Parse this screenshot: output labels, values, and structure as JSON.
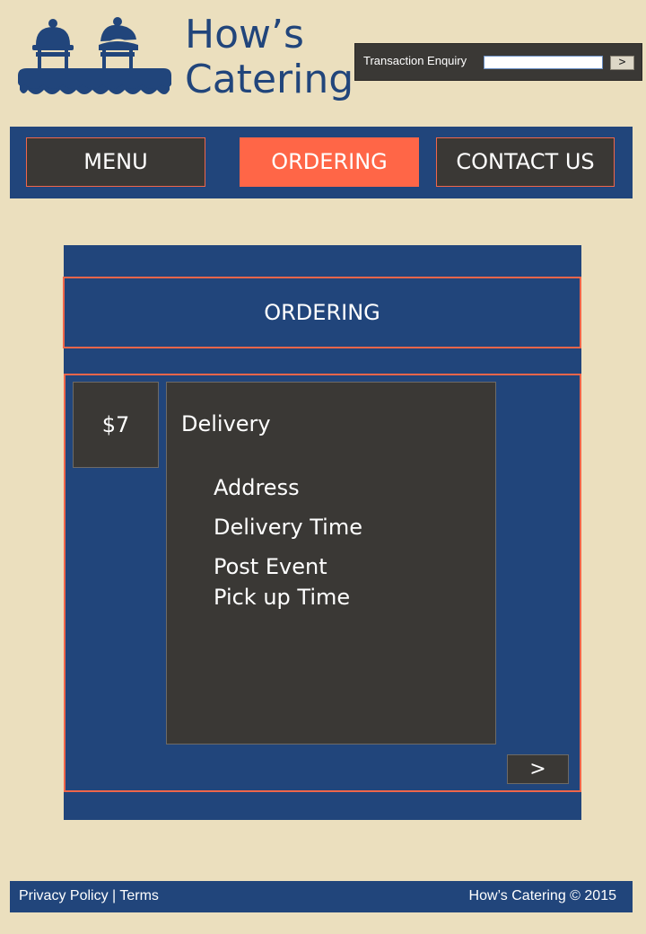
{
  "brand": {
    "line1": "How’s",
    "line2": "Catering"
  },
  "enquiry": {
    "label": "Transaction Enquiry",
    "value": "",
    "submit_label": ">"
  },
  "nav": {
    "menu": "MENU",
    "ordering": "ORDERING",
    "contact": "CONTACT US",
    "active": "ordering"
  },
  "section": {
    "title": "ORDERING"
  },
  "order": {
    "price": "$7",
    "heading": "Delivery",
    "fields": [
      "Address",
      "Delivery Time",
      "Post Event\nPick up Time"
    ],
    "next_label": ">"
  },
  "footer": {
    "privacy": "Privacy Policy",
    "separator": " | ",
    "terms": "Terms",
    "copyright": "How’s Catering © 2015"
  },
  "colors": {
    "background": "#ebdfbe",
    "primary_blue": "#21457b",
    "accent": "#ff6647",
    "dark": "#3a3835"
  }
}
